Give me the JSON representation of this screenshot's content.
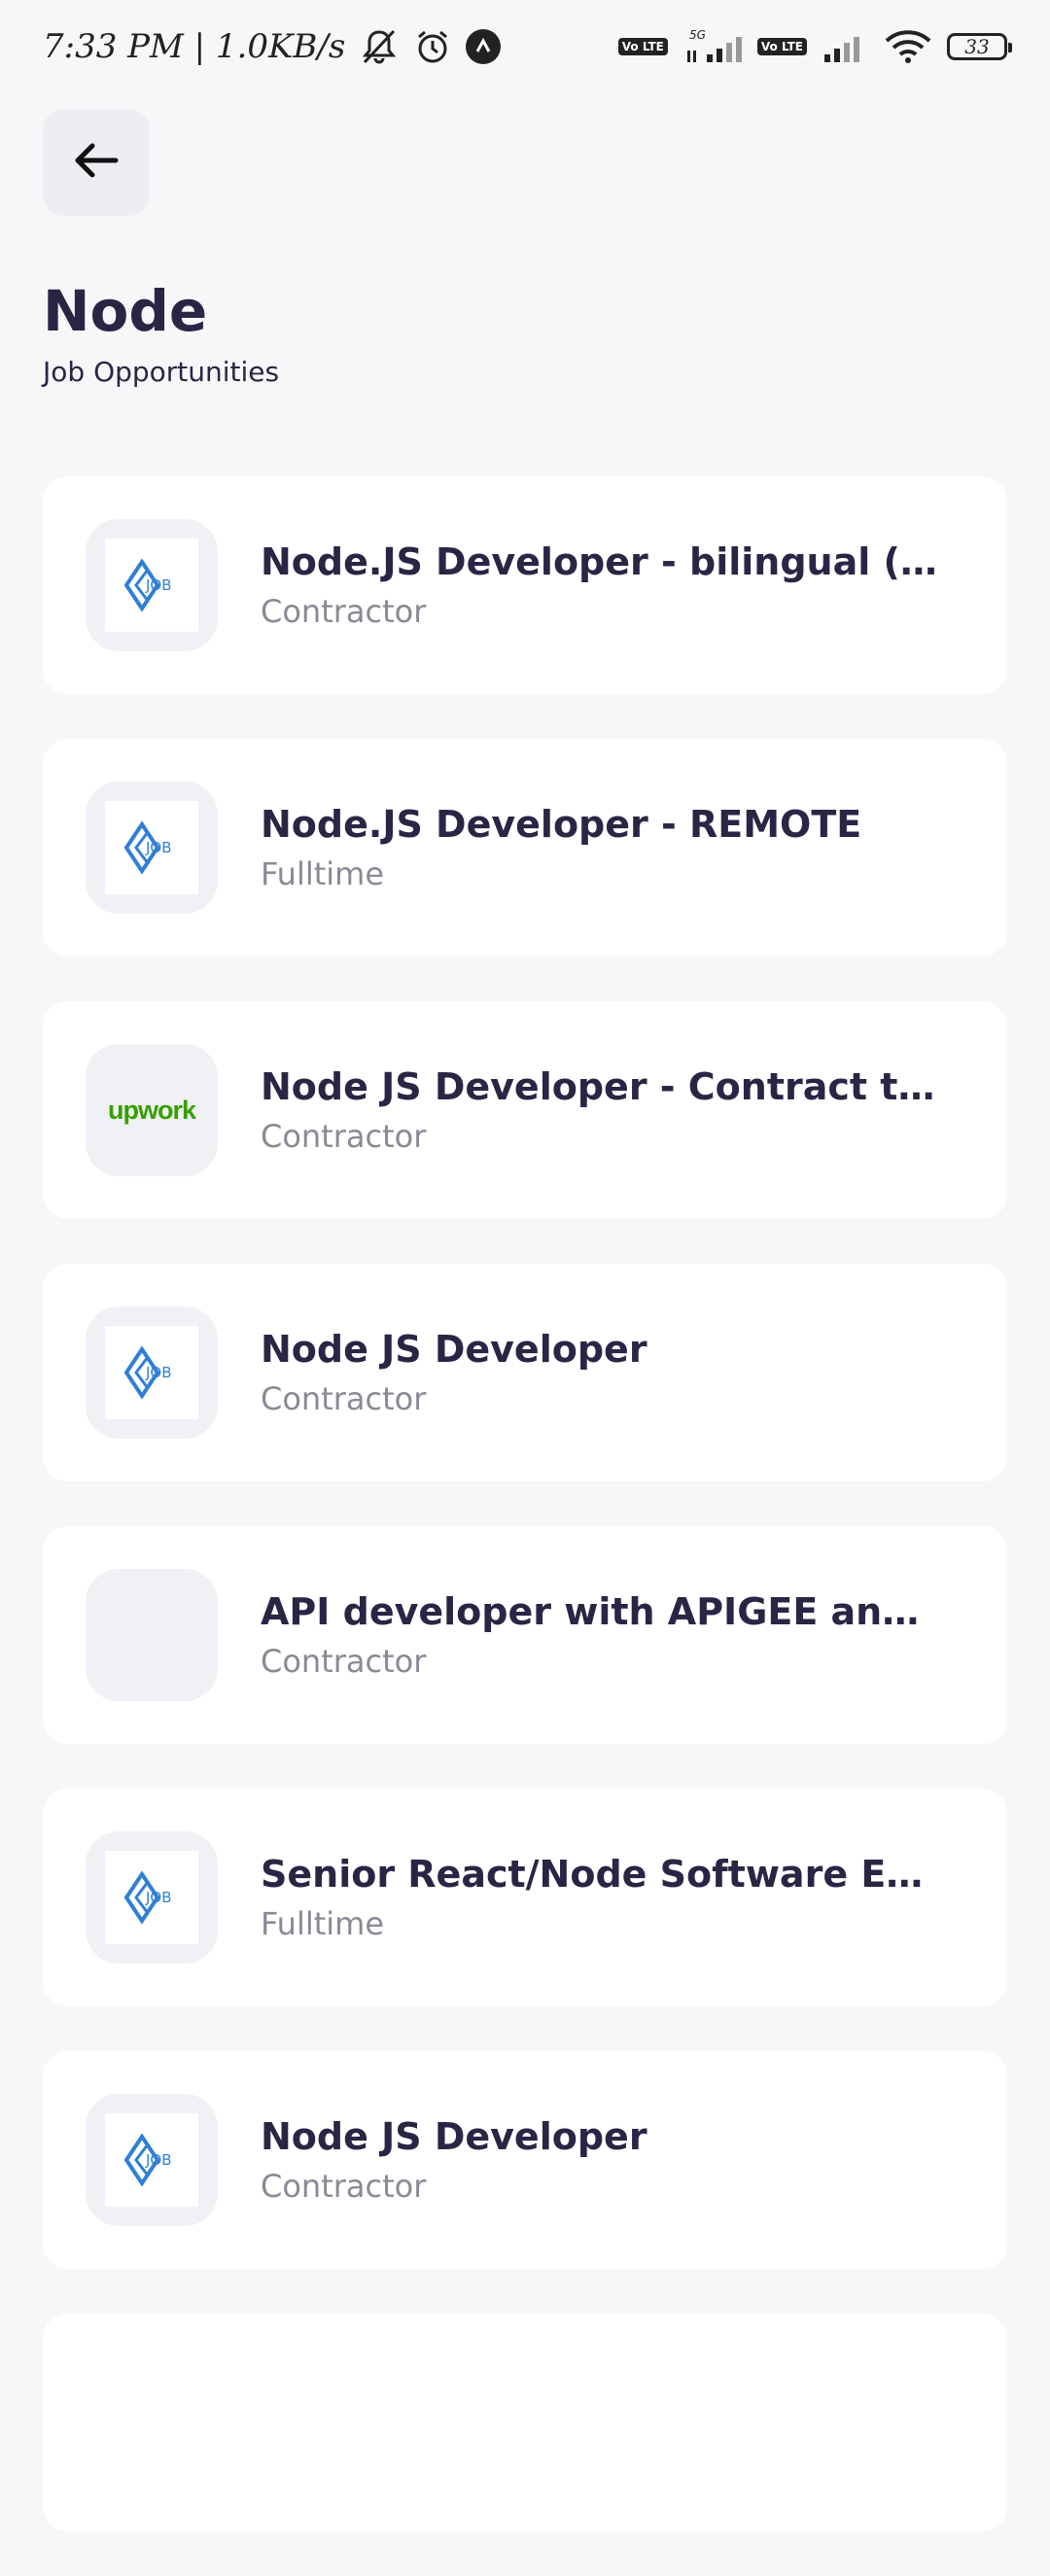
{
  "status_bar": {
    "time_speed": "7:33 PM | 1.0KB/s",
    "net_5g": "5G",
    "volte_label": "Vo LTE",
    "battery": "33"
  },
  "header": {
    "title": "Node",
    "subtitle": "Job Opportunities"
  },
  "jobs": [
    {
      "title": "Node.JS Developer - bilingual (Kore...",
      "type": "Contractor",
      "logo": "job-logo-icon"
    },
    {
      "title": "Node.JS Developer - REMOTE",
      "type": "Fulltime",
      "logo": "job-logo-icon"
    },
    {
      "title": "Node JS Developer - Contract to Hi...",
      "type": "Contractor",
      "logo": "upwork-logo",
      "logo_text": "upwork"
    },
    {
      "title": "Node JS Developer",
      "type": "Contractor",
      "logo": "job-logo-icon"
    },
    {
      "title": "API developer with APIGEE and NO...",
      "type": "Contractor",
      "logo": "empty-logo"
    },
    {
      "title": "Senior React/Node Software Engine...",
      "type": "Fulltime",
      "logo": "job-logo-icon"
    },
    {
      "title": "Node JS Developer",
      "type": "Contractor",
      "logo": "job-logo-icon"
    }
  ]
}
